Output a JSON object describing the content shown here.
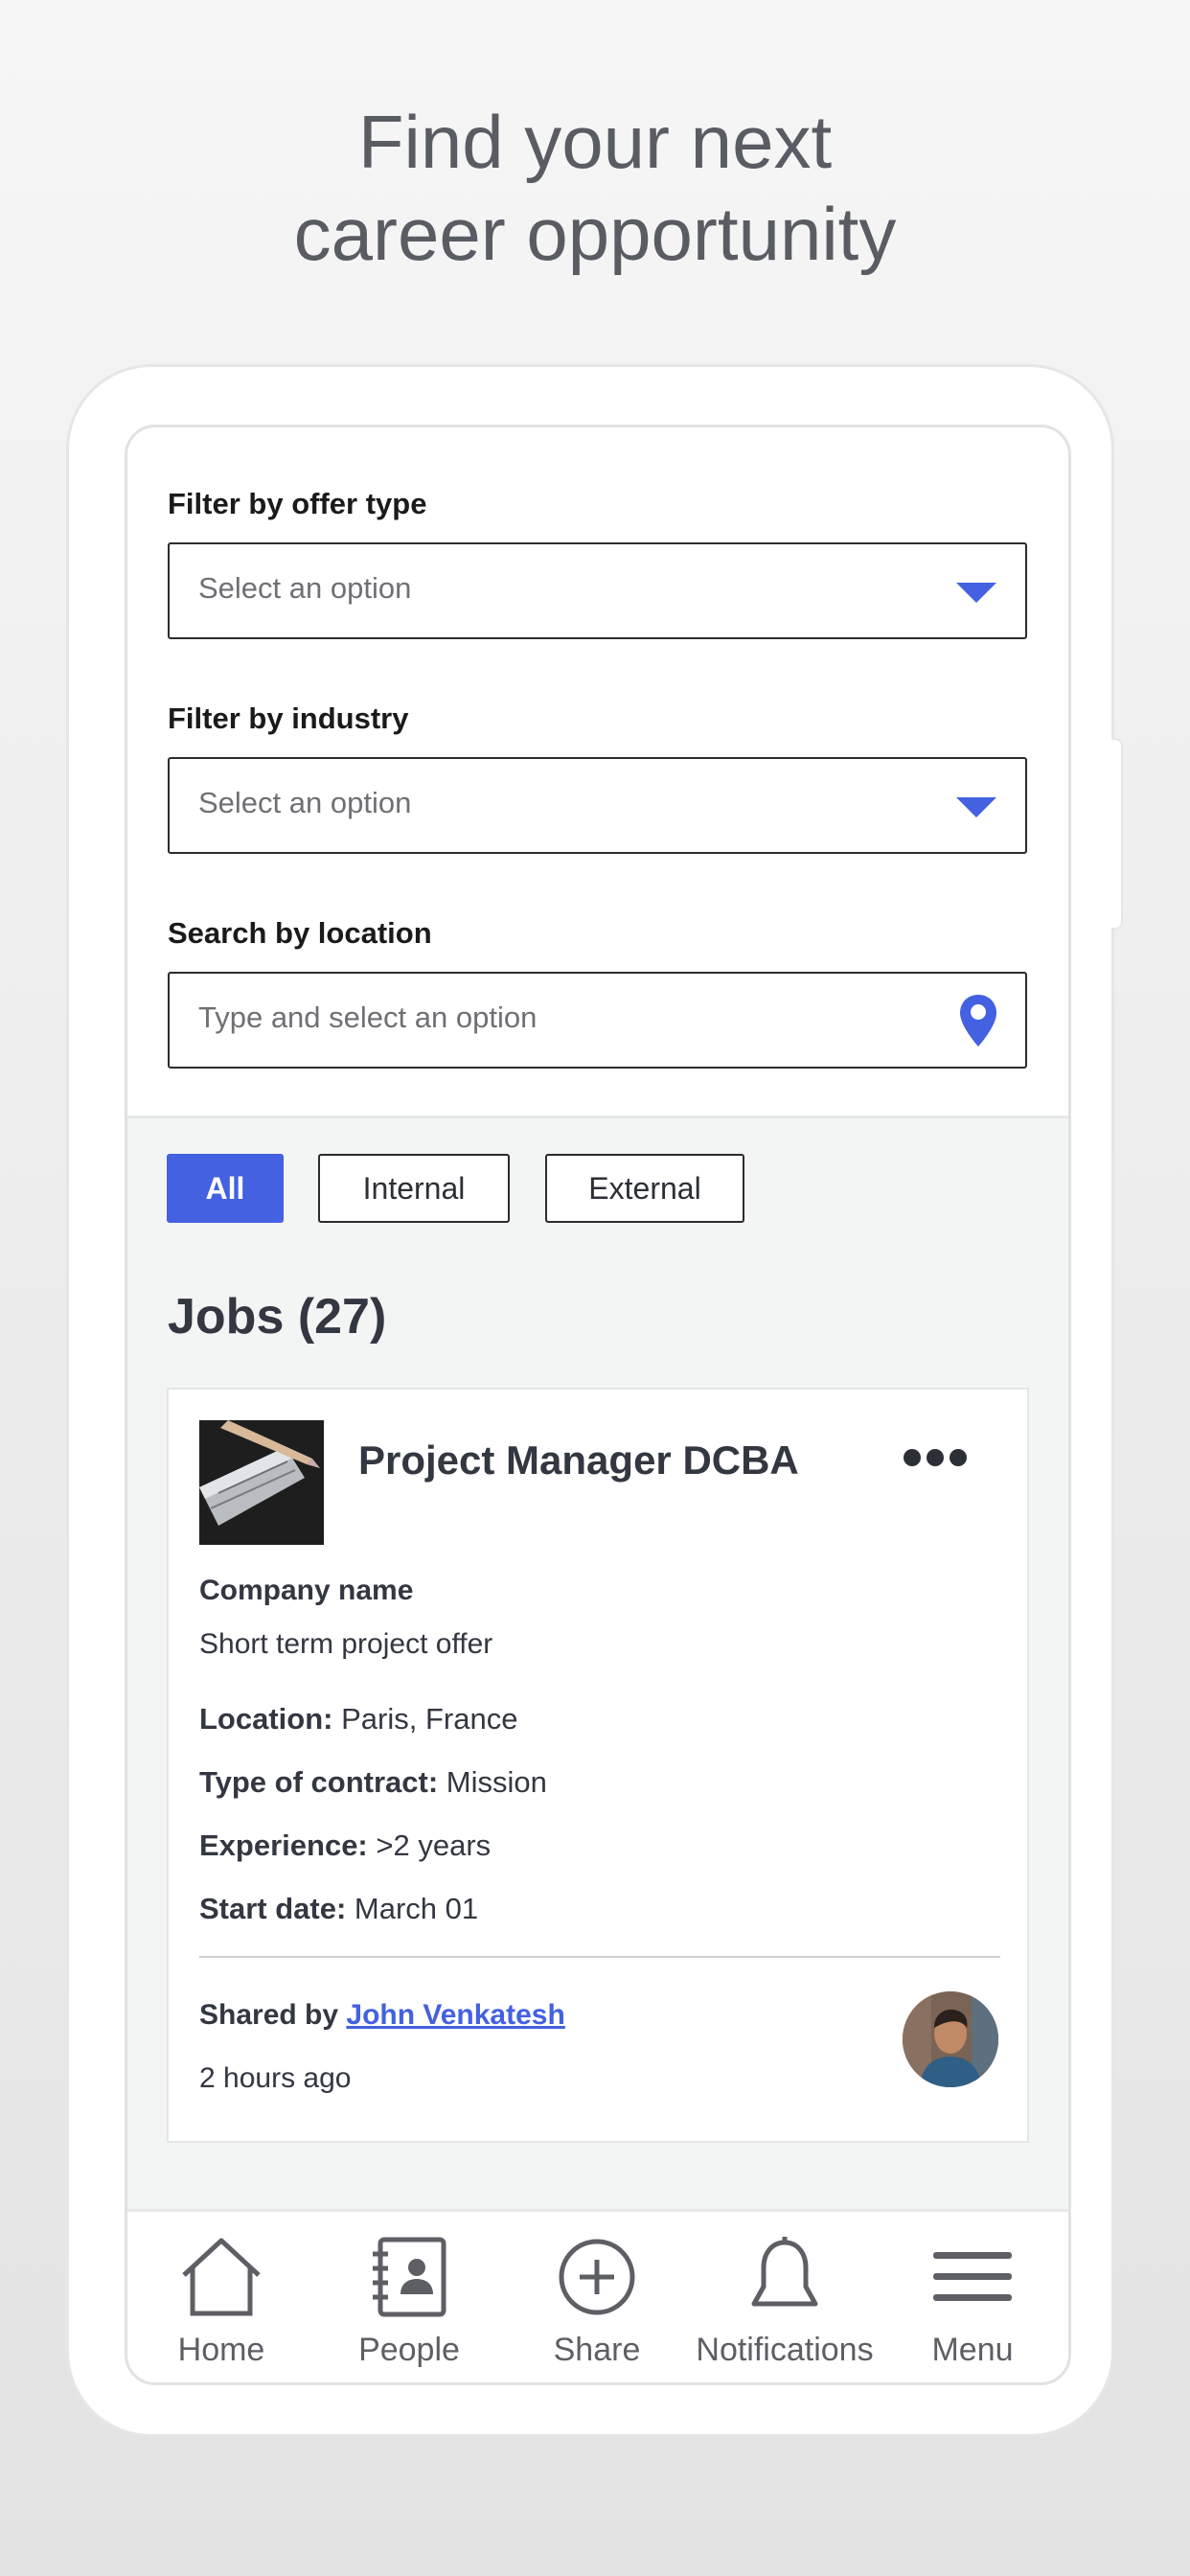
{
  "headline": {
    "line1": "Find your next",
    "line2": "career opportunity"
  },
  "filters": {
    "offer_type": {
      "label": "Filter by offer type",
      "placeholder": "Select an option"
    },
    "industry": {
      "label": "Filter by industry",
      "placeholder": "Select an option"
    },
    "location": {
      "label": "Search by location",
      "placeholder": "Type and select an option"
    }
  },
  "chips": [
    {
      "label": "All",
      "active": true
    },
    {
      "label": "Internal",
      "active": false
    },
    {
      "label": "External",
      "active": false
    }
  ],
  "jobs_title": "Jobs (27)",
  "job": {
    "title": "Project Manager DCBA",
    "company": "Company name",
    "description": "Short term project offer",
    "location_label": "Location:",
    "location": "Paris, France",
    "contract_label": "Type of contract:",
    "contract": "Mission",
    "experience_label": "Experience:",
    "experience": ">2 years",
    "start_label": "Start date:",
    "start": "March 01",
    "shared_by_label": "Shared by",
    "shared_by_name": "John Venkatesh",
    "time_ago": "2 hours ago"
  },
  "tabbar": [
    {
      "label": "Home",
      "icon": "home-icon"
    },
    {
      "label": "People",
      "icon": "contacts-book-icon"
    },
    {
      "label": "Share",
      "icon": "plus-circle-icon"
    },
    {
      "label": "Notifications",
      "icon": "bell-icon"
    },
    {
      "label": "Menu",
      "icon": "hamburger-menu-icon"
    }
  ],
  "colors": {
    "accent": "#4361e0",
    "text": "#333741",
    "tab_icon": "#5d5f64"
  }
}
